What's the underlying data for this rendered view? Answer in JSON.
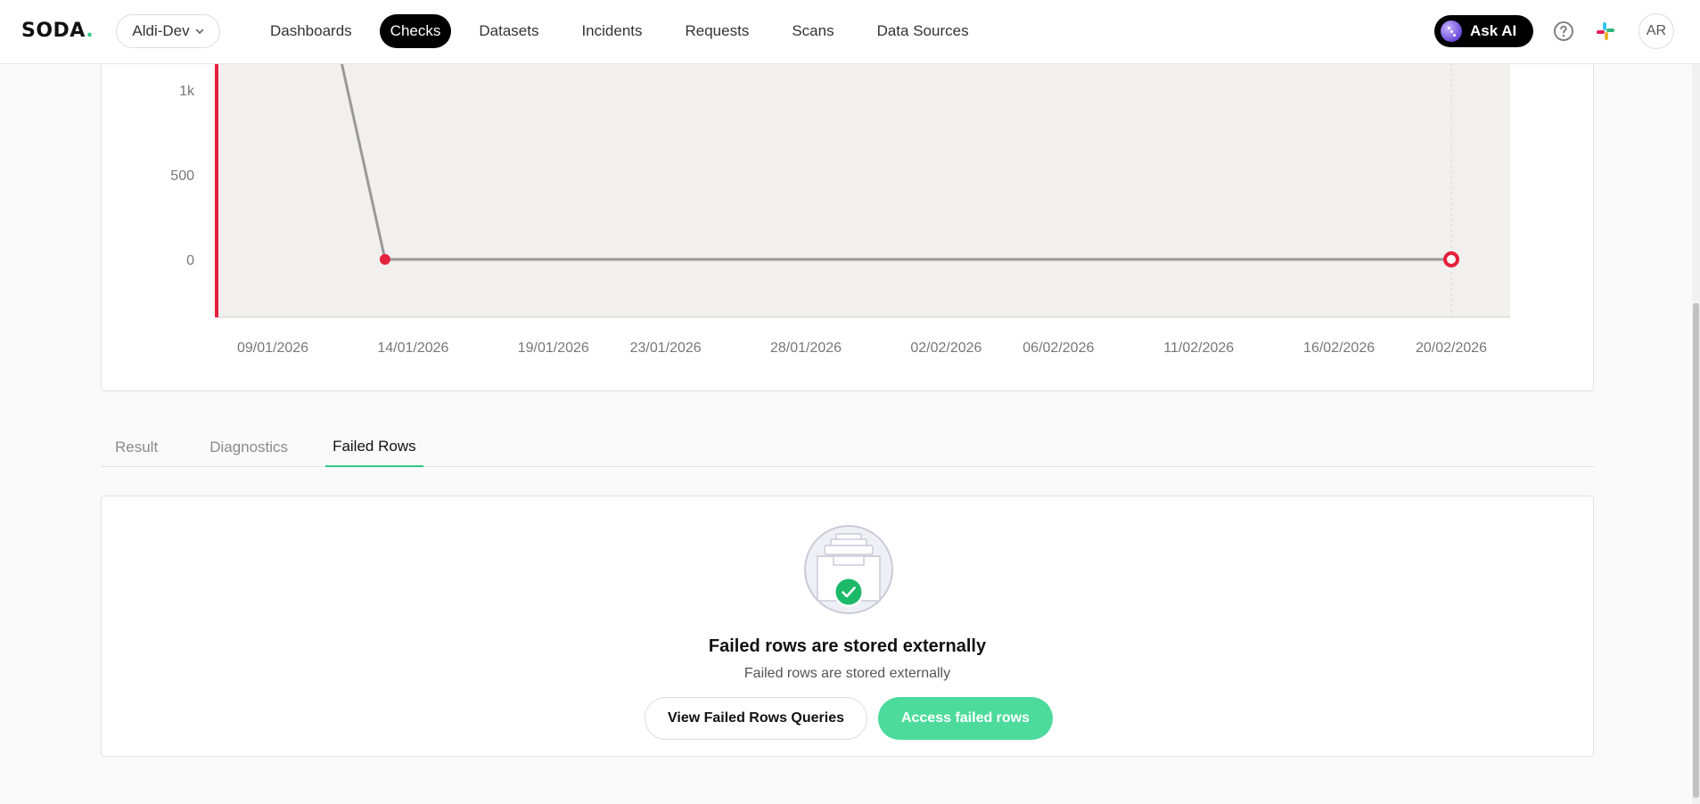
{
  "header": {
    "logo": {
      "text": "SODA",
      "dot": "."
    },
    "org_selector": "Aldi-Dev",
    "nav": [
      "Dashboards",
      "Checks",
      "Datasets",
      "Incidents",
      "Requests",
      "Scans",
      "Data Sources"
    ],
    "active_nav": "Checks",
    "ask_ai": "Ask AI",
    "avatar_initials": "AR"
  },
  "chart_data": {
    "type": "line",
    "y_ticks": [
      "1k",
      "500",
      "0"
    ],
    "x_ticks": [
      "09/01/2026",
      "14/01/2026",
      "19/01/2026",
      "23/01/2026",
      "28/01/2026",
      "02/02/2026",
      "06/02/2026",
      "11/02/2026",
      "16/02/2026",
      "20/02/2026"
    ],
    "series": [
      {
        "points": [
          {
            "x": "11/01/2026",
            "y": 1500
          },
          {
            "x": "13/01/2026",
            "y": 0
          },
          {
            "x": "20/02/2026",
            "y": 0
          }
        ]
      }
    ],
    "failed_points": [
      {
        "x": "13/01/2026",
        "y": 0,
        "marker": "filled"
      },
      {
        "x": "20/02/2026",
        "y": 0,
        "marker": "hollow"
      }
    ],
    "ylim": [
      -350,
      1000
    ],
    "grid": false,
    "colors": {
      "line": "#999999",
      "fail": "#e5213b",
      "plot_bg": "#f1f0ee"
    }
  },
  "tabs": {
    "items": [
      "Result",
      "Diagnostics",
      "Failed Rows"
    ],
    "active": "Failed Rows"
  },
  "failed_rows": {
    "title": "Failed rows are stored externally",
    "subtitle": "Failed rows are stored externally",
    "view_queries_button": "View Failed Rows Queries",
    "access_button": "Access failed rows"
  },
  "colors": {
    "accent": "#2fc986",
    "primary_button": "#4ddb9c",
    "danger": "#e5213b"
  }
}
